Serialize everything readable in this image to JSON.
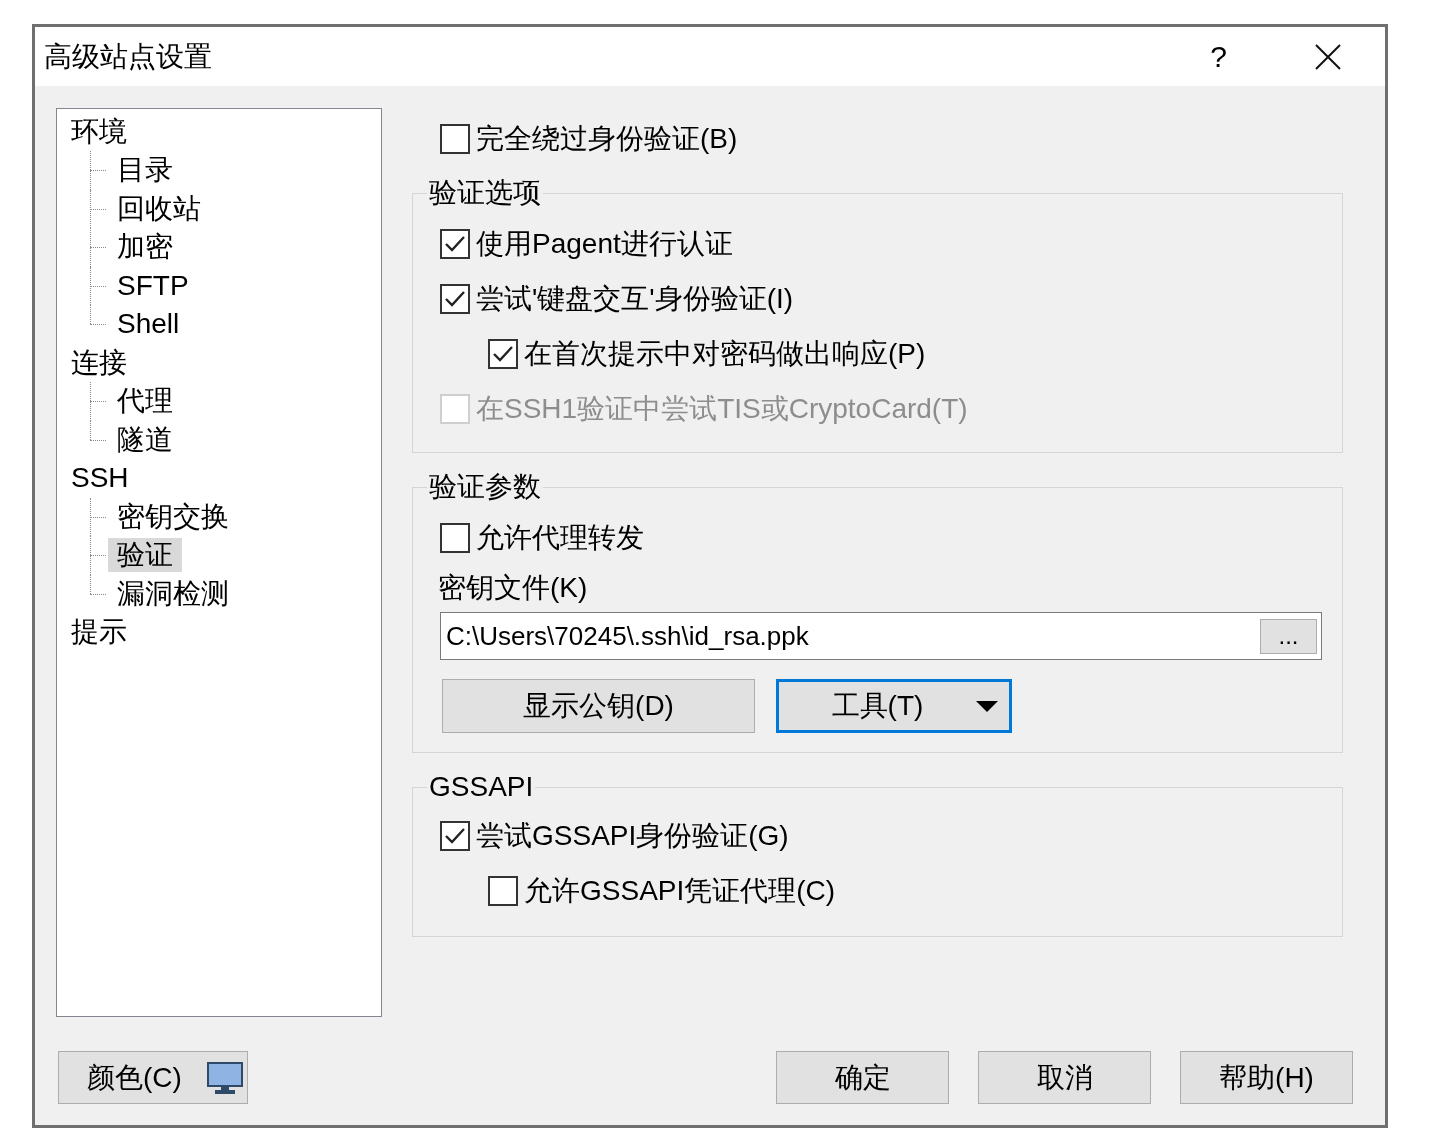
{
  "window": {
    "title": "高级站点设置",
    "help": "?"
  },
  "tree": [
    {
      "label": "环境",
      "selected": false,
      "children": [
        {
          "label": "目录",
          "selected": false
        },
        {
          "label": "回收站",
          "selected": false
        },
        {
          "label": "加密",
          "selected": false
        },
        {
          "label": "SFTP",
          "selected": false
        },
        {
          "label": "Shell",
          "selected": false
        }
      ]
    },
    {
      "label": "连接",
      "selected": false,
      "children": [
        {
          "label": "代理",
          "selected": false
        },
        {
          "label": "隧道",
          "selected": false
        }
      ]
    },
    {
      "label": "SSH",
      "selected": false,
      "children": [
        {
          "label": "密钥交换",
          "selected": false
        },
        {
          "label": "验证",
          "selected": true
        },
        {
          "label": "漏洞检测",
          "selected": false
        }
      ]
    },
    {
      "label": "提示",
      "selected": false
    }
  ],
  "bypass": {
    "label": "完全绕过身份验证(B)",
    "checked": false,
    "disabled": false
  },
  "groups": [
    {
      "title": "验证选项",
      "items": [
        {
          "kind": "checkbox",
          "label": "使用Pagent进行认证",
          "checked": true,
          "disabled": false
        },
        {
          "kind": "checkbox",
          "label": "尝试'键盘交互'身份验证(I)",
          "checked": true,
          "disabled": false,
          "children": [
            {
              "kind": "checkbox",
              "label": "在首次提示中对密码做出响应(P)",
              "checked": true,
              "disabled": false
            }
          ]
        },
        {
          "kind": "checkbox",
          "label": "在SSH1验证中尝试TIS或CryptoCard(T)",
          "checked": false,
          "disabled": true
        }
      ]
    },
    {
      "title": "验证参数",
      "items": [
        {
          "kind": "checkbox",
          "label": "允许代理转发",
          "checked": false,
          "disabled": false
        },
        {
          "kind": "file",
          "label": "密钥文件(K)",
          "value": "C:\\Users\\70245\\.ssh\\id_rsa.ppk",
          "browse": "..."
        },
        {
          "kind": "buttons",
          "buttons": [
            {
              "label": "显示公钥(D)",
              "focused": false,
              "dropdown": false
            },
            {
              "label": "工具(T)",
              "focused": true,
              "dropdown": true
            }
          ]
        }
      ]
    },
    {
      "title": "GSSAPI",
      "items": [
        {
          "kind": "checkbox",
          "label": "尝试GSSAPI身份验证(G)",
          "checked": true,
          "disabled": false,
          "children": [
            {
              "kind": "checkbox",
              "label": "允许GSSAPI凭证代理(C)",
              "checked": false,
              "disabled": false
            }
          ]
        }
      ]
    }
  ],
  "footer": {
    "color_button": {
      "label": "颜色(C)"
    },
    "buttons": [
      {
        "label": "确定"
      },
      {
        "label": "取消"
      },
      {
        "label": "帮助(H)"
      }
    ]
  }
}
